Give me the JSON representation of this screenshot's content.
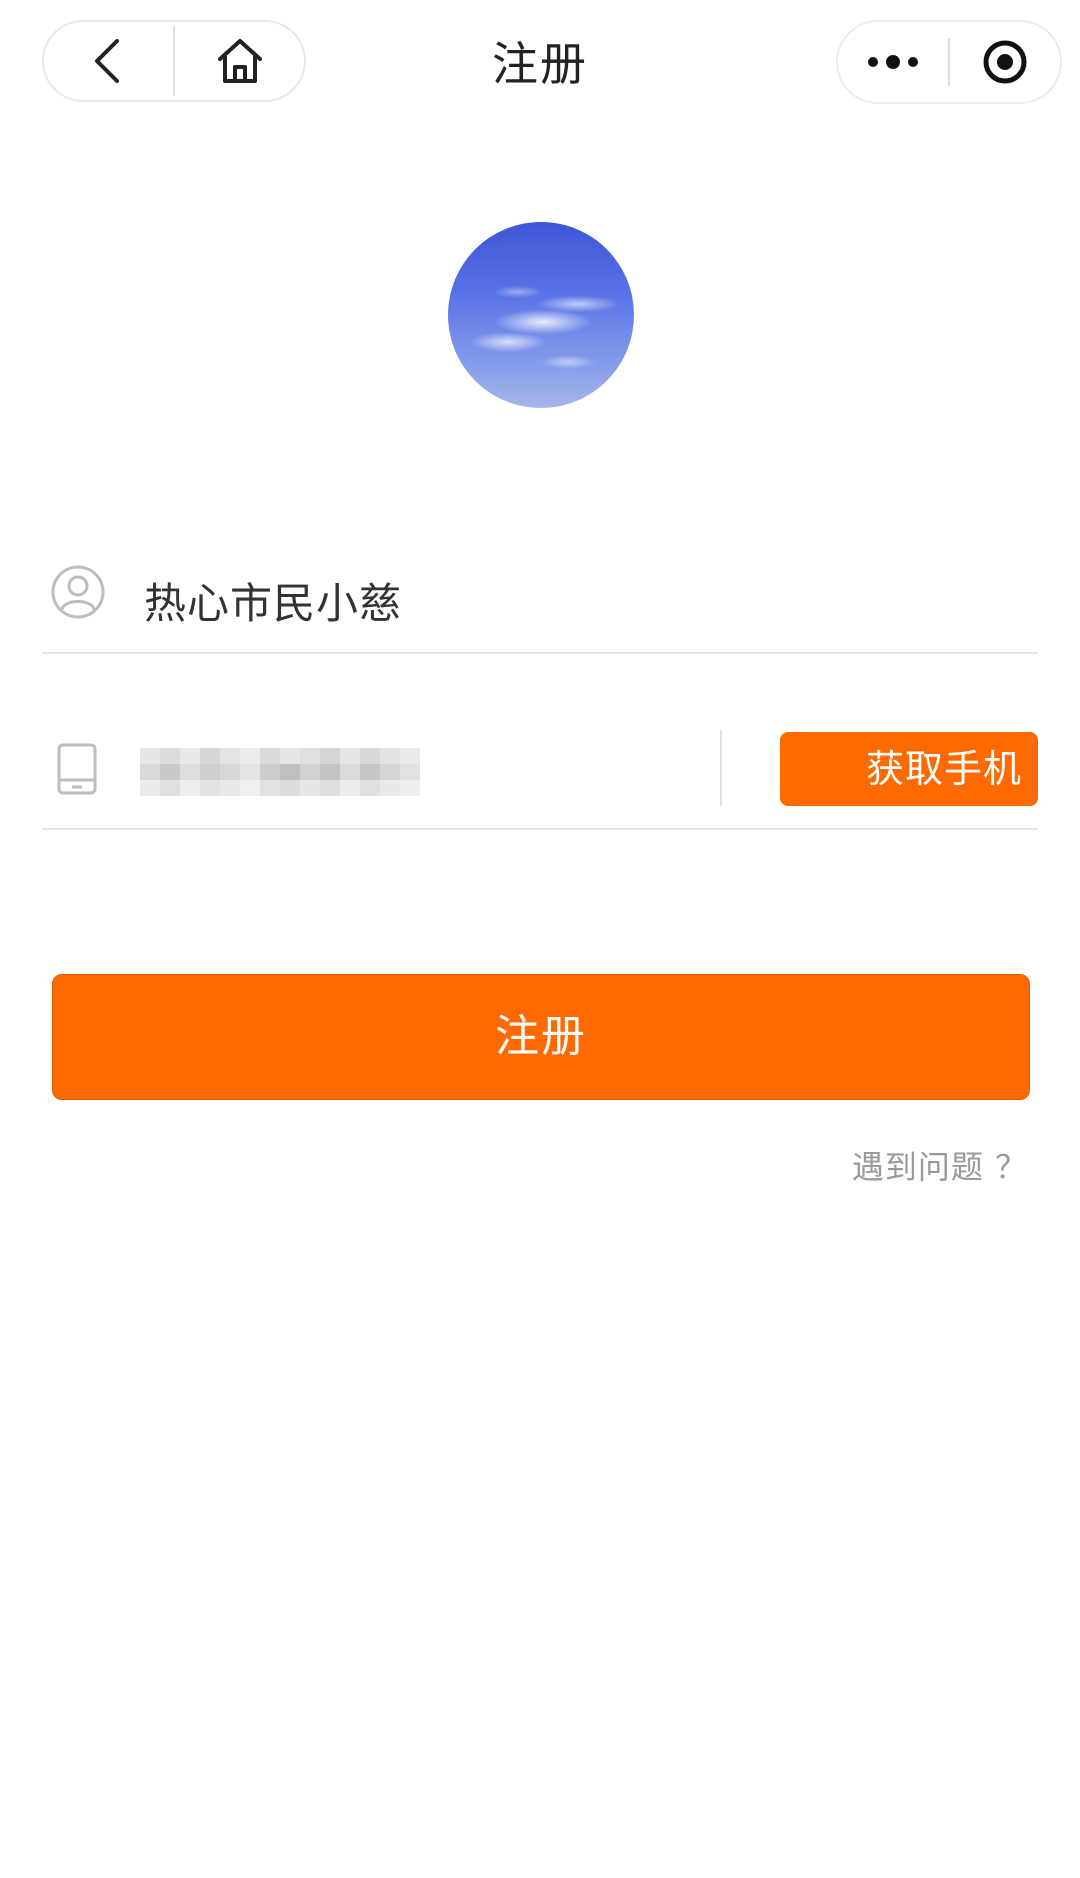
{
  "nav": {
    "title": "注册",
    "back_icon": "chevron-left-icon",
    "home_icon": "home-icon",
    "more_icon": "more-dots-icon",
    "record_icon": "target-icon"
  },
  "form": {
    "nickname": {
      "icon": "user-circle-icon",
      "value": "热心市民小慈"
    },
    "phone": {
      "icon": "phone-icon",
      "value_state": "pixelated/obscured",
      "get_phone_button": "获取手机"
    }
  },
  "actions": {
    "register_button": "注册",
    "help_link": "遇到问题 ？"
  },
  "colors": {
    "accent": "#ff6a00",
    "text": "#333333",
    "muted": "#9a9a9a",
    "divider": "#e5e5e5"
  }
}
